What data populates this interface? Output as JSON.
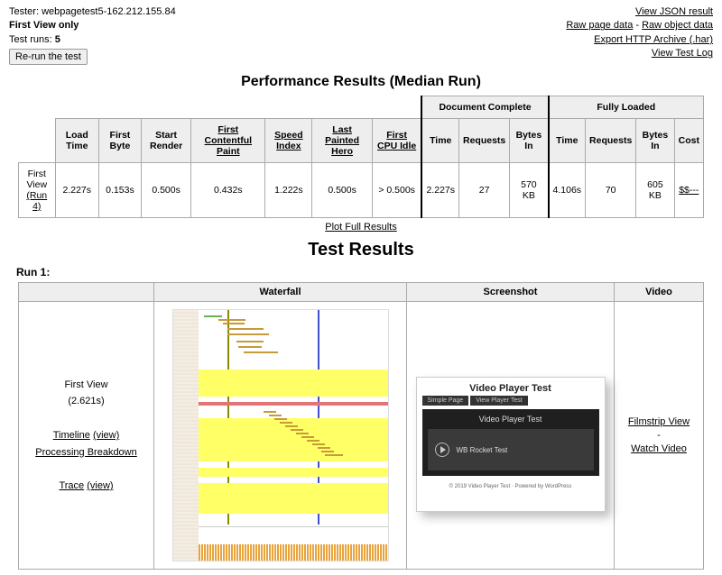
{
  "header": {
    "tester_label": "Tester:",
    "tester_value": "webpagetest5-162.212.155.84",
    "first_view_only": "First View only",
    "test_runs_label": "Test runs:",
    "test_runs_value": "5",
    "rerun_button": "Re-run the test",
    "links": {
      "view_json": "View JSON result",
      "raw_page": "Raw page data",
      "raw_page_sep": " - ",
      "raw_object": "Raw object data",
      "export_har": "Export HTTP Archive (.har)",
      "view_log": "View Test Log"
    }
  },
  "perf": {
    "title": "Performance Results (Median Run)",
    "group_doc": "Document Complete",
    "group_full": "Fully Loaded",
    "cols": {
      "load_time": "Load Time",
      "first_byte": "First Byte",
      "start_render": "Start Render",
      "fcp": "First Contentful Paint",
      "speed_index": "Speed Index",
      "lph": "Last Painted Hero",
      "first_cpu_idle": "First CPU Idle",
      "time": "Time",
      "requests": "Requests",
      "bytes_in": "Bytes In",
      "cost": "Cost"
    },
    "row_label_1": "First View",
    "row_label_2": "(Run 4)",
    "row": {
      "load_time": "2.227s",
      "first_byte": "0.153s",
      "start_render": "0.500s",
      "fcp": "0.432s",
      "speed_index": "1.222s",
      "lph": "0.500s",
      "first_cpu_idle": "> 0.500s",
      "doc_time": "2.227s",
      "doc_req": "27",
      "doc_bytes": "570 KB",
      "full_time": "4.106s",
      "full_req": "70",
      "full_bytes": "605 KB",
      "cost": "$$---"
    },
    "plot_link": "Plot Full Results"
  },
  "results": {
    "title": "Test Results",
    "run_label": "Run 1:",
    "cols": {
      "waterfall": "Waterfall",
      "screenshot": "Screenshot",
      "video": "Video"
    },
    "fv": {
      "title": "First View",
      "time": "(2.621s)",
      "timeline": "Timeline",
      "view1": "(view)",
      "processing": "Processing Breakdown",
      "trace": "Trace",
      "view2": "(view)"
    },
    "video": {
      "filmstrip": "Filmstrip View",
      "dash": "-",
      "watch": "Watch Video"
    },
    "shot": {
      "title": "Video Player Test",
      "tab1": "Simple Page",
      "tab2": "View Player Test",
      "inner_title": "Video Player Test",
      "track": "WB Rocket Test",
      "footer": "© 2019 Video Player Test · Powered by WordPress"
    }
  }
}
